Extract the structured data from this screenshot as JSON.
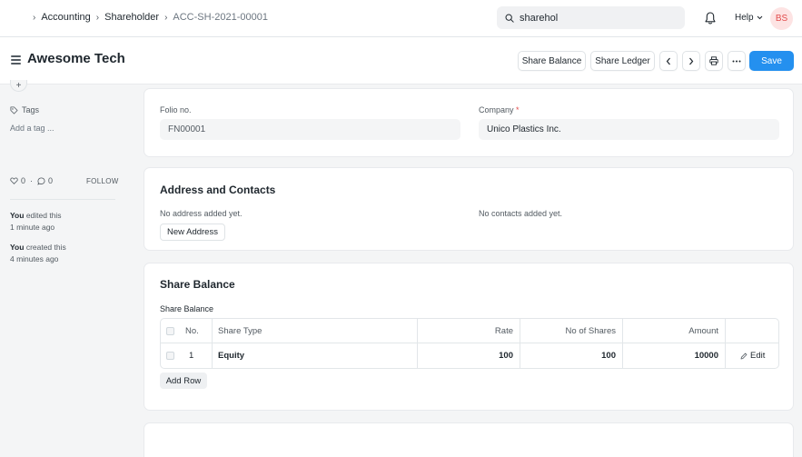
{
  "breadcrumbs": [
    "Accounting",
    "Shareholder",
    "ACC-SH-2021-00001"
  ],
  "search": {
    "value": "sharehol"
  },
  "navbar": {
    "help_label": "Help",
    "avatar_initials": "BS"
  },
  "page": {
    "title": "Awesome Tech",
    "buttons": {
      "share_balance": "Share Balance",
      "share_ledger": "Share Ledger",
      "save": "Save"
    }
  },
  "sidebar": {
    "tags_label": "Tags",
    "add_tag": "Add a tag ...",
    "likes_count": "0",
    "comments_count": "0",
    "follow_label": "FOLLOW",
    "activity": [
      {
        "actor": "You",
        "action": "edited this",
        "time": "1 minute ago"
      },
      {
        "actor": "You",
        "action": "created this",
        "time": "4 minutes ago"
      }
    ]
  },
  "details": {
    "folio_label": "Folio no.",
    "folio_value": "FN00001",
    "company_label": "Company",
    "company_required_mark": "*",
    "company_value": "Unico Plastics Inc."
  },
  "address": {
    "title": "Address and Contacts",
    "no_address": "No address added yet.",
    "no_contacts": "No contacts added yet.",
    "new_address_button": "New Address"
  },
  "share_balance": {
    "title": "Share Balance",
    "table_label": "Share Balance",
    "columns": [
      "No.",
      "Share Type",
      "Rate",
      "No of Shares",
      "Amount"
    ],
    "rows": [
      {
        "no": "1",
        "share_type": "Equity",
        "rate": "100",
        "no_of_shares": "100",
        "amount": "10000",
        "edit_label": "Edit"
      }
    ],
    "add_row_button": "Add Row"
  },
  "colors": {
    "primary": "#2490ef",
    "avatar_bg": "#fde3e3",
    "avatar_text": "#e24c4c"
  }
}
